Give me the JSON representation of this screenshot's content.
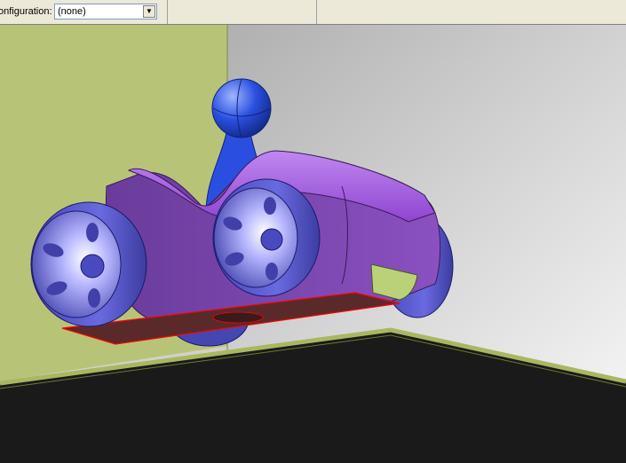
{
  "toolbar": {
    "configuration_label": "onfiguration:",
    "configuration_value": "(none)",
    "dropdown_arrow": "▼"
  },
  "viewport": {
    "scene": "3d-cad-toy-car-model",
    "colors": {
      "left_wall": "#b7c478",
      "back_wall": "#c9c9c9",
      "floor": "#1a1a1a",
      "floor_edge": "#a8b860",
      "body": "#9b59d6",
      "wheel": "#5a5ad0",
      "driver": "#2a4fe0",
      "selected_face": "#5a2a2a",
      "selection_edge": "#ff0000"
    }
  }
}
